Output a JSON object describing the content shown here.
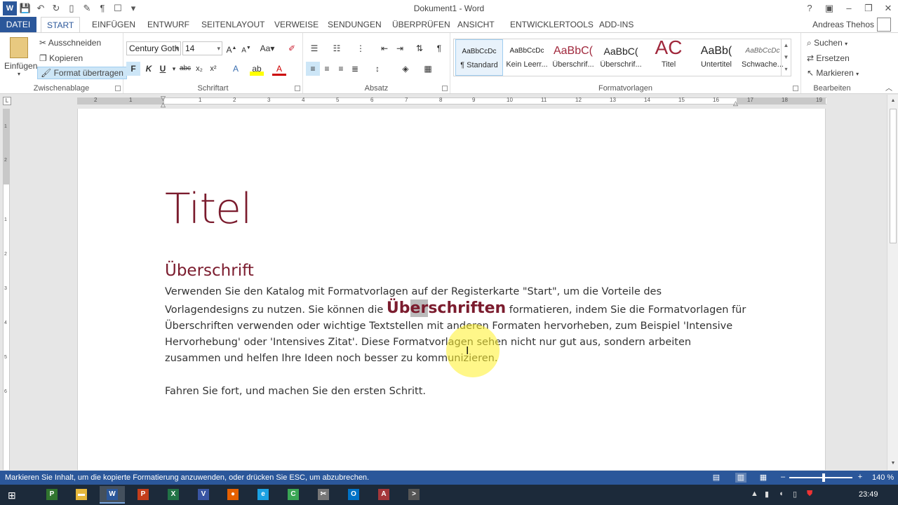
{
  "window": {
    "title": "Dokument1 - Word",
    "user": "Andreas Thehos"
  },
  "tabs": {
    "file": "DATEI",
    "items": [
      "START",
      "EINFÜGEN",
      "ENTWURF",
      "SEITENLAYOUT",
      "VERWEISE",
      "SENDUNGEN",
      "ÜBERPRÜFEN",
      "ANSICHT",
      "ENTWICKLERTOOLS",
      "ADD-INS"
    ],
    "active": "START"
  },
  "ribbon": {
    "clipboard": {
      "label": "Zwischenablage",
      "paste": "Einfügen",
      "cut": "Ausschneiden",
      "copy": "Kopieren",
      "format_painter": "Format übertragen"
    },
    "font": {
      "label": "Schriftart",
      "family": "Century Goth",
      "size": "14"
    },
    "paragraph": {
      "label": "Absatz"
    },
    "styles": {
      "label": "Formatvorlagen",
      "items": [
        {
          "preview": "AaBbCcDc",
          "name": "¶ Standard"
        },
        {
          "preview": "AaBbCcDc",
          "name": "Kein Leerr..."
        },
        {
          "preview": "AaBbC(",
          "name": "Überschrif..."
        },
        {
          "preview": "AaBbC(",
          "name": "Überschrif..."
        },
        {
          "preview": "AC",
          "name": "Titel"
        },
        {
          "preview": "AaBb(",
          "name": "Untertitel"
        },
        {
          "preview": "AaBbCcDc",
          "name": "Schwache..."
        }
      ]
    },
    "editing": {
      "label": "Bearbeiten",
      "find": "Suchen",
      "replace": "Ersetzen",
      "select": "Markieren"
    }
  },
  "document": {
    "title": "Titel",
    "heading": "Überschrift",
    "para1_a": "Verwenden Sie den Katalog mit Formatvorlagen auf der Registerkarte \"Start\", um die Vorteile des Vorlagendesigns zu nutzen. Sie können die ",
    "para1_sel1": "Üb",
    "para1_sel2": "er",
    "para1_sel3": "schriften",
    "para1_b": " formatieren, indem Sie die Formatvorlagen für Überschriften verwenden oder wichtige Textstellen mit anderen Formaten hervorheben, zum Beispiel 'Intensive Hervorhebung' oder 'Intensives Zitat'. Diese Formatvorlagen sehen nicht nur gut aus, sondern arbeiten zusammen und helfen Ihre Ideen noch besser zu kommunizieren.",
    "para2": "Fahren Sie fort, und machen Sie den ersten Schritt."
  },
  "ruler": {
    "top_numbers": [
      "2",
      "1",
      "1",
      "2",
      "3",
      "4",
      "5",
      "6",
      "7",
      "8",
      "9",
      "10",
      "11",
      "12",
      "13",
      "14",
      "15",
      "16",
      "17",
      "18",
      "19"
    ],
    "left_numbers": [
      "1",
      "2",
      "1",
      "2",
      "3",
      "4",
      "5",
      "6"
    ]
  },
  "status": {
    "message": "Markieren Sie Inhalt, um die kopierte Formatierung anzuwenden, oder drücken Sie ESC, um abzubrechen.",
    "zoom": "140 %",
    "zoom_level": 0.4
  },
  "taskbar": {
    "apps": [
      {
        "icon": "project-icon",
        "glyph": "P"
      },
      {
        "icon": "explorer-icon",
        "glyph": "▬"
      },
      {
        "icon": "word-icon",
        "glyph": "W"
      },
      {
        "icon": "powerpoint-icon",
        "glyph": "P"
      },
      {
        "icon": "excel-icon",
        "glyph": "X"
      },
      {
        "icon": "visio-icon",
        "glyph": "V"
      },
      {
        "icon": "firefox-icon",
        "glyph": "●"
      },
      {
        "icon": "ie-icon",
        "glyph": "e"
      },
      {
        "icon": "camtasia-icon",
        "glyph": "C"
      },
      {
        "icon": "snipping-icon",
        "glyph": "✂"
      },
      {
        "icon": "outlook-icon",
        "glyph": "O"
      },
      {
        "icon": "access-icon",
        "glyph": "A"
      },
      {
        "icon": "powershell-icon",
        "glyph": ">"
      }
    ],
    "clock": "23:49"
  },
  "colors": {
    "accent": "#2b579a",
    "heading": "#7b1c2e",
    "highlight": "#fff028"
  }
}
